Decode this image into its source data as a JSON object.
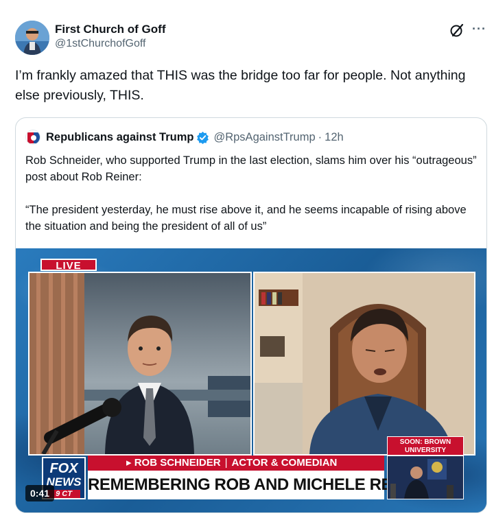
{
  "post": {
    "author_name": "First Church of Goff",
    "author_handle": "@1stChurchofGoff",
    "text": "I’m frankly amazed that THIS was the bridge too far for people. Not anything else previously, THIS.",
    "grok_icon": "grok-slash-icon",
    "more_icon": "more-horizontal-icon"
  },
  "quote": {
    "author_name": "Republicans against Trump",
    "verified": true,
    "author_handle": "@RpsAgainstTrump",
    "dot": "·",
    "time": "12h",
    "text_line1": "Rob Schneider, who supported Trump in the last election, slams him over his “outrageous” post about Rob Reiner:",
    "text_line2": "“The president yesterday, he must rise above it, and he seems incapable of rising above the situation and being the president of all of us”",
    "video": {
      "live_label": "LIVE",
      "chyron_top_name": "ROB SCHNEIDER",
      "chyron_top_sep": "|",
      "chyron_top_role": "ACTOR & COMEDIAN",
      "chyron_main": "REMEMBERING ROB AND MICHELE REINER",
      "logo_line1": "FOX",
      "logo_line2": "NEWS",
      "logo_line3": "9 CT",
      "soon_text": "SOON: BROWN UNIVERSITY SHOOTING UPDATE",
      "timecode": "0:41"
    }
  },
  "colors": {
    "accent": "#1d9bf0",
    "fox_red": "#c8102e",
    "fox_blue": "#0c3a78"
  }
}
